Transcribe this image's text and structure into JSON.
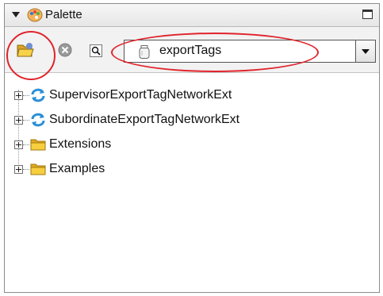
{
  "palette": {
    "title": "Palette",
    "icon": "palette-icon"
  },
  "toolbar": {
    "open_icon": "open-folder-icon",
    "close_icon": "close-circle-icon",
    "find_icon": "search-icon",
    "module_value": "exportTags",
    "module_icon": "jar-icon"
  },
  "tree": {
    "items": [
      {
        "label": "SupervisorExportTagNetworkExt",
        "icon": "network-sync-icon"
      },
      {
        "label": "SubordinateExportTagNetworkExt",
        "icon": "network-sync-icon"
      },
      {
        "label": "Extensions",
        "icon": "folder-icon"
      },
      {
        "label": "Examples",
        "icon": "folder-icon"
      }
    ]
  },
  "colors": {
    "highlight": "#e0242c",
    "folder": "#f2c230",
    "sync": "#2b8fd6"
  }
}
